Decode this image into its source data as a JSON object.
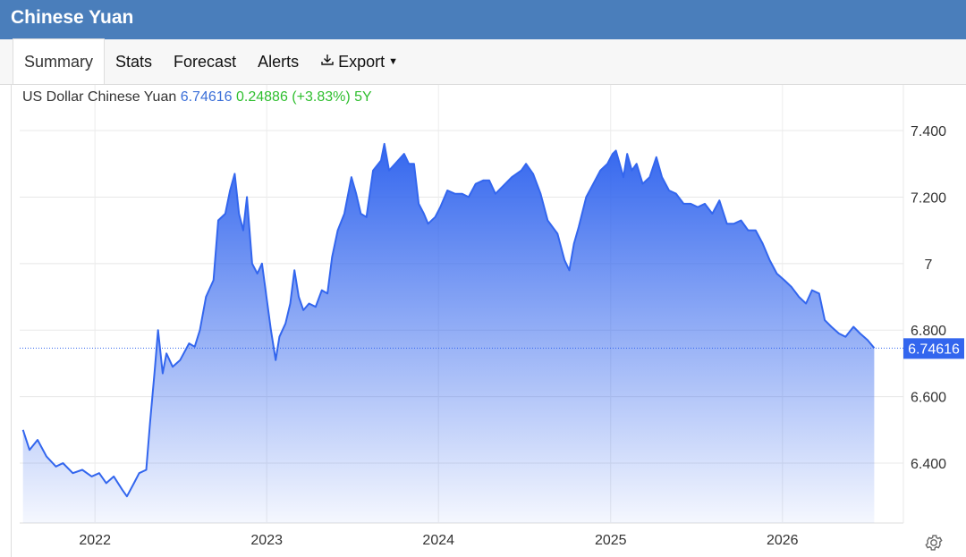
{
  "title": "Chinese Yuan",
  "tabs": [
    {
      "label": "Summary",
      "active": true
    },
    {
      "label": "Stats"
    },
    {
      "label": "Forecast"
    },
    {
      "label": "Alerts"
    },
    {
      "label": "Export",
      "icon": "download-icon",
      "dropdown": true
    }
  ],
  "quote": {
    "name": "US Dollar Chinese Yuan",
    "price": "6.74616",
    "change": "0.24886",
    "change_pct": "(+3.83%)",
    "range": "5Y",
    "price_color": "#3b6fd8",
    "change_color": "#2fbf2f"
  },
  "settings_icon": "gear-icon",
  "colors": {
    "line": "#3366ee",
    "fill_top": "#3366ee",
    "header": "#4a7ebb"
  },
  "chart_data": {
    "type": "area",
    "series": [
      {
        "values": [
          [
            "2021-08-01",
            6.5
          ],
          [
            "2021-08-15",
            6.44
          ],
          [
            "2021-09-01",
            6.47
          ],
          [
            "2021-09-20",
            6.42
          ],
          [
            "2021-10-10",
            6.39
          ],
          [
            "2021-10-25",
            6.4
          ],
          [
            "2021-11-15",
            6.37
          ],
          [
            "2021-12-05",
            6.38
          ],
          [
            "2021-12-25",
            6.36
          ],
          [
            "2022-01-10",
            6.37
          ],
          [
            "2022-01-25",
            6.34
          ],
          [
            "2022-02-10",
            6.36
          ],
          [
            "2022-02-28",
            6.32
          ],
          [
            "2022-03-10",
            6.3
          ],
          [
            "2022-03-25",
            6.34
          ],
          [
            "2022-04-05",
            6.37
          ],
          [
            "2022-04-20",
            6.38
          ],
          [
            "2022-04-28",
            6.52
          ],
          [
            "2022-05-08",
            6.68
          ],
          [
            "2022-05-15",
            6.8
          ],
          [
            "2022-05-25",
            6.67
          ],
          [
            "2022-06-02",
            6.73
          ],
          [
            "2022-06-15",
            6.69
          ],
          [
            "2022-07-01",
            6.71
          ],
          [
            "2022-07-20",
            6.76
          ],
          [
            "2022-08-01",
            6.75
          ],
          [
            "2022-08-12",
            6.8
          ],
          [
            "2022-08-25",
            6.9
          ],
          [
            "2022-09-10",
            6.95
          ],
          [
            "2022-09-20",
            7.13
          ],
          [
            "2022-10-05",
            7.15
          ],
          [
            "2022-10-15",
            7.22
          ],
          [
            "2022-10-25",
            7.27
          ],
          [
            "2022-11-03",
            7.15
          ],
          [
            "2022-11-12",
            7.1
          ],
          [
            "2022-11-20",
            7.2
          ],
          [
            "2022-12-01",
            7.0
          ],
          [
            "2022-12-12",
            6.97
          ],
          [
            "2022-12-22",
            7.0
          ],
          [
            "2023-01-10",
            6.8
          ],
          [
            "2023-01-20",
            6.71
          ],
          [
            "2023-01-28",
            6.78
          ],
          [
            "2023-02-10",
            6.82
          ],
          [
            "2023-02-20",
            6.88
          ],
          [
            "2023-03-01",
            6.98
          ],
          [
            "2023-03-10",
            6.9
          ],
          [
            "2023-03-20",
            6.86
          ],
          [
            "2023-04-01",
            6.88
          ],
          [
            "2023-04-15",
            6.87
          ],
          [
            "2023-04-28",
            6.92
          ],
          [
            "2023-05-10",
            6.91
          ],
          [
            "2023-05-20",
            7.02
          ],
          [
            "2023-06-01",
            7.1
          ],
          [
            "2023-06-15",
            7.15
          ],
          [
            "2023-06-30",
            7.26
          ],
          [
            "2023-07-10",
            7.21
          ],
          [
            "2023-07-20",
            7.15
          ],
          [
            "2023-08-01",
            7.14
          ],
          [
            "2023-08-15",
            7.28
          ],
          [
            "2023-09-01",
            7.31
          ],
          [
            "2023-09-08",
            7.36
          ],
          [
            "2023-09-18",
            7.28
          ],
          [
            "2023-10-01",
            7.3
          ],
          [
            "2023-10-20",
            7.33
          ],
          [
            "2023-10-30",
            7.3
          ],
          [
            "2023-11-10",
            7.3
          ],
          [
            "2023-11-20",
            7.18
          ],
          [
            "2023-12-01",
            7.15
          ],
          [
            "2023-12-10",
            7.12
          ],
          [
            "2023-12-25",
            7.14
          ],
          [
            "2024-01-05",
            7.17
          ],
          [
            "2024-01-20",
            7.22
          ],
          [
            "2024-02-05",
            7.21
          ],
          [
            "2024-02-20",
            7.21
          ],
          [
            "2024-03-05",
            7.2
          ],
          [
            "2024-03-20",
            7.24
          ],
          [
            "2024-04-05",
            7.25
          ],
          [
            "2024-04-18",
            7.25
          ],
          [
            "2024-05-01",
            7.21
          ],
          [
            "2024-05-15",
            7.23
          ],
          [
            "2024-06-05",
            7.26
          ],
          [
            "2024-06-25",
            7.28
          ],
          [
            "2024-07-05",
            7.3
          ],
          [
            "2024-07-20",
            7.27
          ],
          [
            "2024-08-05",
            7.21
          ],
          [
            "2024-08-20",
            7.13
          ],
          [
            "2024-09-10",
            7.09
          ],
          [
            "2024-09-25",
            7.01
          ],
          [
            "2024-10-05",
            6.98
          ],
          [
            "2024-10-15",
            7.06
          ],
          [
            "2024-10-25",
            7.11
          ],
          [
            "2024-11-10",
            7.2
          ],
          [
            "2024-11-25",
            7.24
          ],
          [
            "2024-12-10",
            7.28
          ],
          [
            "2024-12-25",
            7.3
          ],
          [
            "2025-01-05",
            7.33
          ],
          [
            "2025-01-12",
            7.34
          ],
          [
            "2025-01-20",
            7.3
          ],
          [
            "2025-01-28",
            7.26
          ],
          [
            "2025-02-05",
            7.33
          ],
          [
            "2025-02-15",
            7.28
          ],
          [
            "2025-02-25",
            7.3
          ],
          [
            "2025-03-10",
            7.24
          ],
          [
            "2025-03-25",
            7.26
          ],
          [
            "2025-04-08",
            7.32
          ],
          [
            "2025-04-20",
            7.26
          ],
          [
            "2025-05-05",
            7.22
          ],
          [
            "2025-05-20",
            7.21
          ],
          [
            "2025-06-05",
            7.18
          ],
          [
            "2025-06-20",
            7.18
          ],
          [
            "2025-07-05",
            7.17
          ],
          [
            "2025-07-20",
            7.18
          ],
          [
            "2025-08-05",
            7.15
          ],
          [
            "2025-08-20",
            7.19
          ],
          [
            "2025-09-05",
            7.12
          ],
          [
            "2025-09-20",
            7.12
          ],
          [
            "2025-10-05",
            7.13
          ],
          [
            "2025-10-20",
            7.1
          ],
          [
            "2025-11-05",
            7.1
          ],
          [
            "2025-11-20",
            7.06
          ],
          [
            "2025-12-05",
            7.01
          ],
          [
            "2025-12-20",
            6.97
          ],
          [
            "2026-01-05",
            6.95
          ],
          [
            "2026-01-20",
            6.93
          ],
          [
            "2026-02-05",
            6.9
          ],
          [
            "2026-02-20",
            6.88
          ],
          [
            "2026-03-05",
            6.92
          ],
          [
            "2026-03-20",
            6.91
          ],
          [
            "2026-04-01",
            6.83
          ],
          [
            "2026-04-15",
            6.81
          ],
          [
            "2026-05-01",
            6.79
          ],
          [
            "2026-05-15",
            6.78
          ],
          [
            "2026-06-01",
            6.81
          ],
          [
            "2026-06-15",
            6.79
          ],
          [
            "2026-07-01",
            6.77
          ],
          [
            "2026-07-15",
            6.746
          ]
        ]
      }
    ],
    "x_ticks": [
      "2022",
      "2023",
      "2024",
      "2025",
      "2026"
    ],
    "y_ticks": [
      "6.400",
      "6.600",
      "6.800",
      "7",
      "7.200",
      "7.400"
    ],
    "ylim": [
      6.22,
      7.47
    ],
    "xlim": [
      "2021-07-25",
      "2026-09-15"
    ],
    "last_value_label": "6.74616",
    "y_axis_position": "right",
    "grid": true
  }
}
